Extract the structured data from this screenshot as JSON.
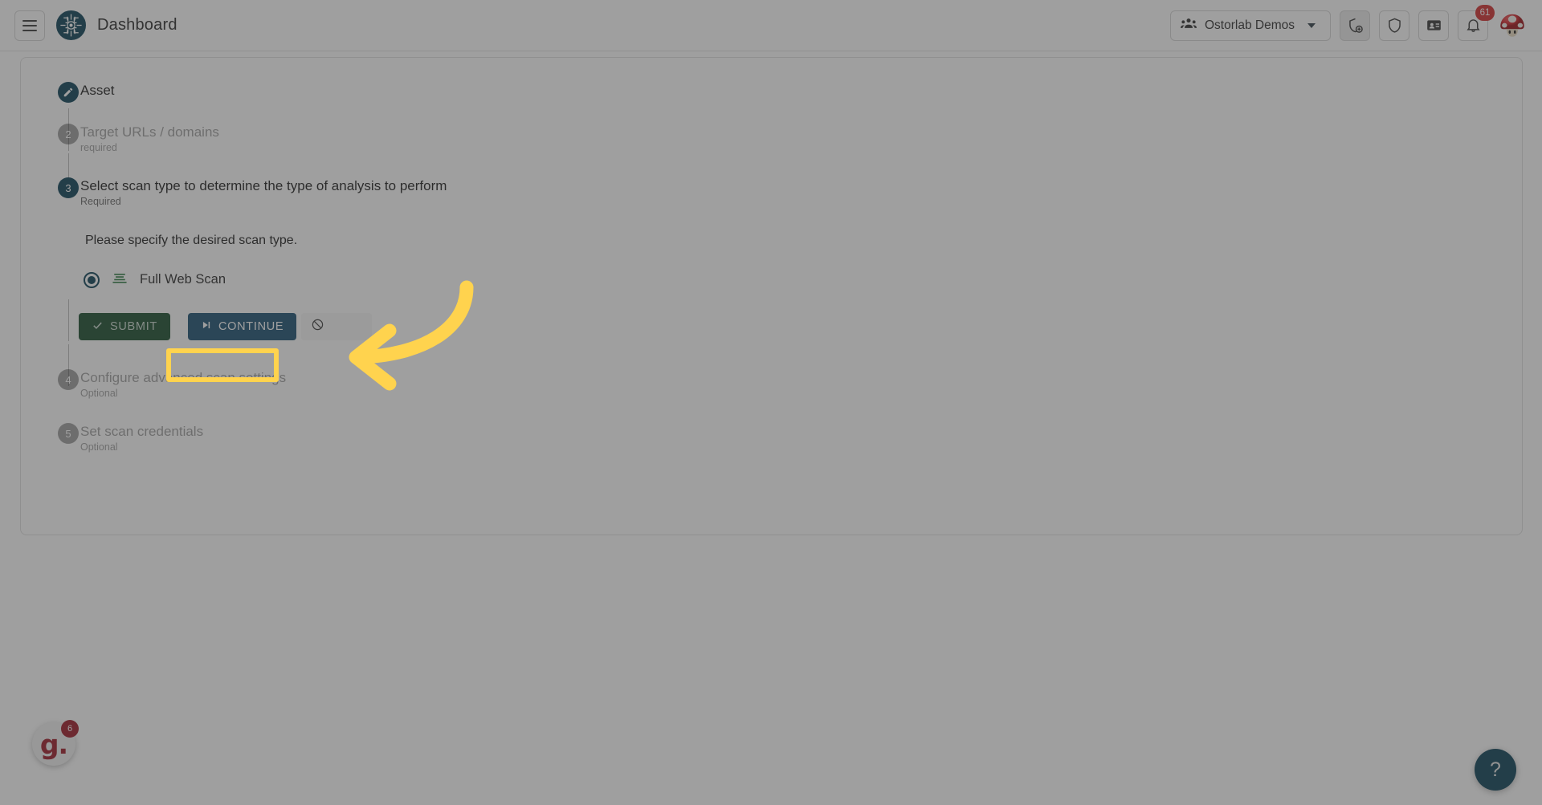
{
  "header": {
    "menu_icon": "hamburger-menu-icon",
    "logo_icon": "ostorlab-circuit-logo",
    "title": "Dashboard",
    "org_selector": {
      "icon": "group-people-icon",
      "label": "Ostorlab Demos",
      "chevron": "chevron-down-icon"
    },
    "actions": [
      {
        "name": "add-scan-shield-icon",
        "icon": "shield-plus-icon",
        "active": true
      },
      {
        "name": "security-shield-icon",
        "icon": "shield-icon",
        "active": false
      },
      {
        "name": "ticket-icon",
        "icon": "id-card-icon",
        "active": false
      },
      {
        "name": "notifications-icon",
        "icon": "bell-icon",
        "active": false,
        "badge": "61"
      }
    ],
    "avatar": {
      "name": "user-avatar",
      "icon": "mushroom-avatar"
    }
  },
  "wizard": {
    "steps": [
      {
        "index": "1",
        "state": "done",
        "bullet": "pencil-edit-icon",
        "label": "Asset",
        "sub": ""
      },
      {
        "index": "2",
        "state": "idle",
        "bullet": "2",
        "label": "Target URLs / domains",
        "sub": "required"
      },
      {
        "index": "3",
        "state": "active",
        "bullet": "3",
        "label": "Select scan type to determine the type of analysis to perform",
        "sub": "Required"
      },
      {
        "index": "4",
        "state": "idle",
        "bullet": "4",
        "label": "Configure advanced scan settings",
        "sub": "Optional"
      },
      {
        "index": "5",
        "state": "idle",
        "bullet": "5",
        "label": "Set scan credentials",
        "sub": "Optional"
      }
    ],
    "active_step_content": {
      "hint": "Please specify the desired scan type.",
      "options": [
        {
          "selected": true,
          "icon": "web-scan-list-icon",
          "label": "Full Web Scan"
        }
      ],
      "buttons": {
        "submit": {
          "label": "SUBMIT",
          "icon": "check-icon"
        },
        "continue": {
          "label": "CONTINUE",
          "icon": "skip-next-icon"
        },
        "cancel": {
          "label": "",
          "icon": "block-circle-slash-icon"
        }
      }
    }
  },
  "floating": {
    "guidde": {
      "logo_text": "g.",
      "badge": "6"
    },
    "help": {
      "label": "?",
      "icon": "question-mark-icon"
    }
  },
  "annotation": {
    "highlight_color": "#ffd34e",
    "arrow_icon": "curved-arrow-left-icon",
    "target": "CONTINUE"
  },
  "colors": {
    "brand_dark": "#0d4257",
    "submit_green": "#1b4d2e",
    "continue_blue": "#1d5273",
    "badge_red": "#d3302f",
    "highlight_yellow": "#ffd34e"
  }
}
